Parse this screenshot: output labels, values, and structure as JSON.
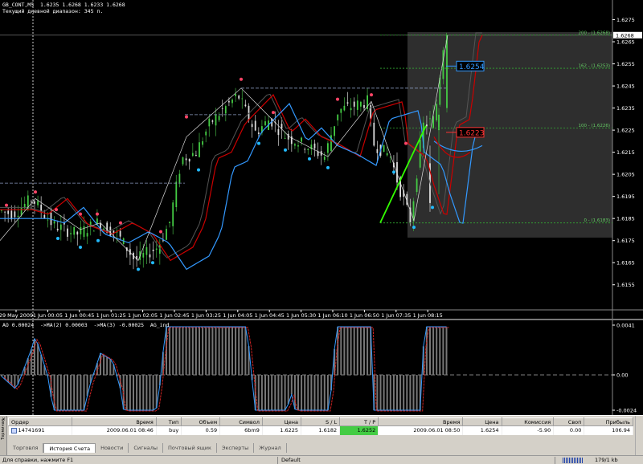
{
  "window": {
    "title": "GB_CONT,M5"
  },
  "chart": {
    "symbol_line": "GB_CONT,M5  1.6235 1.6268 1.6233 1.6268",
    "range_line": "Текущий дневной диапазон: 345 п.",
    "current_price_tag": "1.6268",
    "price_ticks": [
      "1.6275",
      "1.6265",
      "1.6255",
      "1.6245",
      "1.6235",
      "1.6225",
      "1.6215",
      "1.6205",
      "1.6195",
      "1.6185",
      "1.6175",
      "1.6165",
      "1.6155"
    ],
    "time_ticks": [
      "29 May 2009",
      "1 Jun 00:05",
      "1 Jun 00:45",
      "1 Jun 01:25",
      "1 Jun 02:05",
      "1 Jun 02:45",
      "1 Jun 03:25",
      "1 Jun 04:05",
      "1 Jun 04:45",
      "1 Jun 05:30",
      "1 Jun 06:10",
      "1 Jun 06:50",
      "1 Jun 07:35",
      "1 Jun 08:15"
    ],
    "fib_levels": [
      {
        "label": "200 - (1.6268)",
        "price": 1.6268
      },
      {
        "label": "162 - (1.6253)",
        "price": 1.6253
      },
      {
        "label": "100 - (1.6226)",
        "price": 1.6226
      },
      {
        "label": "0 - (1.6183)",
        "price": 1.6183
      }
    ],
    "target_box": {
      "label": "1.6254",
      "color": "#3399ff"
    },
    "stop_box": {
      "label": "1.6223",
      "color": "#ff3333"
    },
    "colors": {
      "bull": "#00cc00",
      "bear": "#cc0000",
      "ma_red": "#cc0000",
      "ma_blue": "#3399ff",
      "fractal_up": "#ff4466",
      "fractal_down": "#22bbff",
      "impulse": "#33ff00"
    }
  },
  "oscillator": {
    "header": "AO 0.00024  ->MA(2) 0.00003  ->MA(3) -0.00025  AG_ind",
    "ticks": [
      "0.0041",
      "0.00",
      "-0.0024"
    ]
  },
  "terminal": {
    "columns": [
      "Ордер",
      "Время",
      "Тип",
      "Объем",
      "Символ",
      "Цена",
      "S / L",
      "T / P",
      "Время",
      "Цена",
      "Комиссия",
      "Своп",
      "Прибыль"
    ],
    "rows": [
      {
        "order": "14741691",
        "open_time": "2009.06.01 08:46",
        "type": "buy",
        "volume": "0.59",
        "symbol": "6bm9",
        "price": "1.6225",
        "sl": "1.6182",
        "tp": "1.6252",
        "close_time": "2009.06.01 08:50",
        "close_price": "1.6254",
        "commission": "-5.90",
        "swap": "0.00",
        "profit": "106.94"
      }
    ],
    "side_label": "Терминал",
    "tabs": [
      "Торговля",
      "История Счета",
      "Новости",
      "Сигналы",
      "Почтовый ящик",
      "Эксперты",
      "Журнал"
    ],
    "active_tab": 1
  },
  "statusbar": {
    "help": "Для справки, нажмите F1",
    "profile": "Default",
    "traffic": "179/1 kb"
  }
}
